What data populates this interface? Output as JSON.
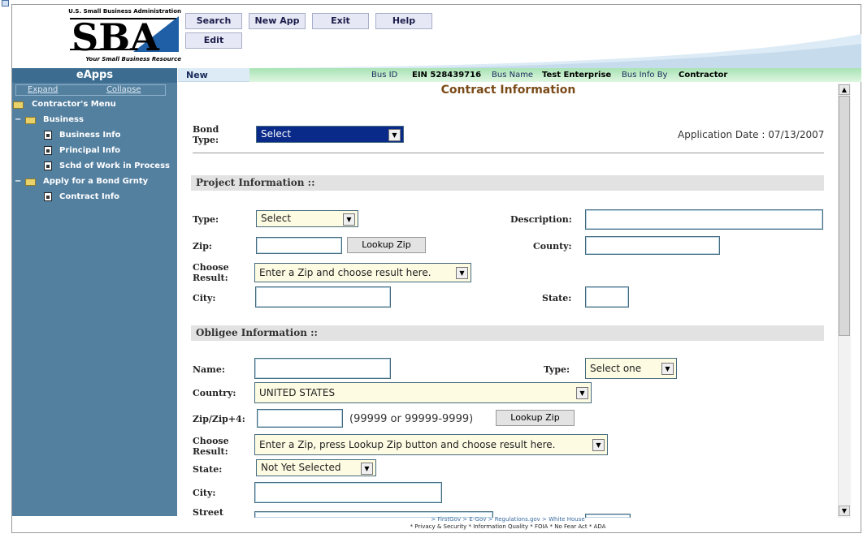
{
  "header": {
    "org_name": "U.S. Small Business Administration",
    "logo_text": "SBA",
    "tagline": "Your Small Business Resource",
    "buttons": {
      "search": "Search",
      "new_app": "New App",
      "exit": "Exit",
      "help": "Help",
      "edit": "Edit"
    }
  },
  "sidebar": {
    "title": "eApps",
    "expand": "Expand",
    "collapse": "Collapse",
    "menu_title": "Contractor's Menu",
    "items": [
      {
        "label": "Business"
      },
      {
        "label": "Business Info"
      },
      {
        "label": "Principal Info"
      },
      {
        "label": "Schd of Work in Process"
      },
      {
        "label": "Apply for a Bond Grnty"
      },
      {
        "label": "Contract Info"
      }
    ]
  },
  "infobar": {
    "status": "New",
    "bus_id_label": "Bus ID",
    "bus_id_value": "EIN 528439716",
    "bus_name_label": "Bus Name",
    "bus_name_value": "Test Enterprise",
    "bus_info_by_label": "Bus Info By",
    "bus_info_by_value": "Contractor"
  },
  "page": {
    "title": "Contract Information",
    "bond_type_label": "Bond Type:",
    "bond_type_value": "Select",
    "application_date": "Application Date : 07/13/2007"
  },
  "project": {
    "section_title": "Project Information ::",
    "type_label": "Type:",
    "type_value": "Select",
    "description_label": "Description:",
    "zip_label": "Zip:",
    "lookup_zip": "Lookup Zip",
    "county_label": "County:",
    "choose_result_label": "Choose Result:",
    "choose_result_value": "Enter a Zip and choose result here.",
    "city_label": "City:",
    "state_label": "State:"
  },
  "obligee": {
    "section_title": "Obligee Information ::",
    "name_label": "Name:",
    "type_label": "Type:",
    "type_value": "Select one",
    "country_label": "Country:",
    "country_value": "UNITED STATES",
    "zip_label": "Zip/Zip+4:",
    "zip_hint": "(99999 or 99999-9999)",
    "lookup_zip": "Lookup Zip",
    "choose_result_label": "Choose Result:",
    "choose_result_value": "Enter a Zip, press Lookup Zip button and choose result here.",
    "state_label": "State:",
    "state_value": "Not Yet Selected",
    "city_label": "City:",
    "street_label": "Street"
  },
  "footer": {
    "links": "> FirstGov    > E-Gov    > Regulations.gov    > White House",
    "policies": "* Privacy & Security  * Information Quality  * FOIA  * No Fear Act  * ADA"
  },
  "colors": {
    "sidebar": "#5480a0",
    "sidebar_header": "#3c6d90",
    "info_bar": "#a8e3b4",
    "title": "#7a4a18"
  }
}
